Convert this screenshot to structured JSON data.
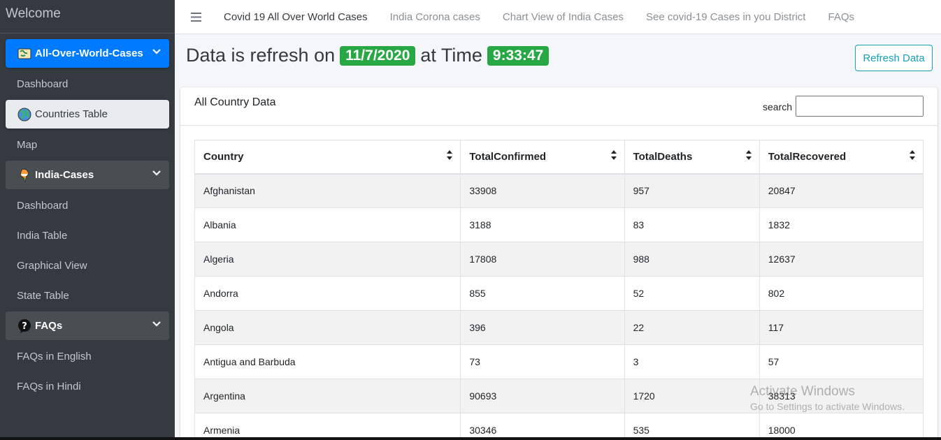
{
  "sidebar": {
    "brand": "Welcome",
    "items": [
      {
        "label": "All-Over-World-Cases"
      },
      {
        "label": "Dashboard"
      },
      {
        "label": "Countries Table"
      },
      {
        "label": "Map"
      },
      {
        "label": "India-Cases"
      },
      {
        "label": "Dashboard"
      },
      {
        "label": "India Table"
      },
      {
        "label": "Graphical View"
      },
      {
        "label": "State Table"
      },
      {
        "label": "FAQs"
      },
      {
        "label": "FAQs in English"
      },
      {
        "label": "FAQs in Hindi"
      }
    ]
  },
  "topnav": {
    "links": [
      "Covid 19 All Over World Cases",
      "India Corona cases",
      "Chart View of India Cases",
      "See covid-19 Cases in you District",
      "FAQs"
    ]
  },
  "header": {
    "prefix": "Data is refresh on",
    "date": "11/7/2020",
    "middle": "at Time",
    "time": "9:33:47",
    "refresh_button": "Refresh Data"
  },
  "card": {
    "title": "All Country Data",
    "search_label": "search",
    "search_value": ""
  },
  "table": {
    "columns": [
      "Country",
      "TotalConfirmed",
      "TotalDeaths",
      "TotalRecovered"
    ],
    "rows": [
      [
        "Afghanistan",
        "33908",
        "957",
        "20847"
      ],
      [
        "Albania",
        "3188",
        "83",
        "1832"
      ],
      [
        "Algeria",
        "17808",
        "988",
        "12637"
      ],
      [
        "Andorra",
        "855",
        "52",
        "802"
      ],
      [
        "Angola",
        "396",
        "22",
        "117"
      ],
      [
        "Antigua and Barbuda",
        "73",
        "3",
        "57"
      ],
      [
        "Argentina",
        "90693",
        "1720",
        "38313"
      ],
      [
        "Armenia",
        "30346",
        "535",
        "18000"
      ]
    ]
  },
  "watermark": {
    "line1": "Activate Windows",
    "line2": "Go to Settings to activate Windows."
  },
  "colors": {
    "sidebar_bg": "#343a40",
    "primary": "#007bff",
    "success": "#28a745",
    "info": "#17a2b8"
  }
}
